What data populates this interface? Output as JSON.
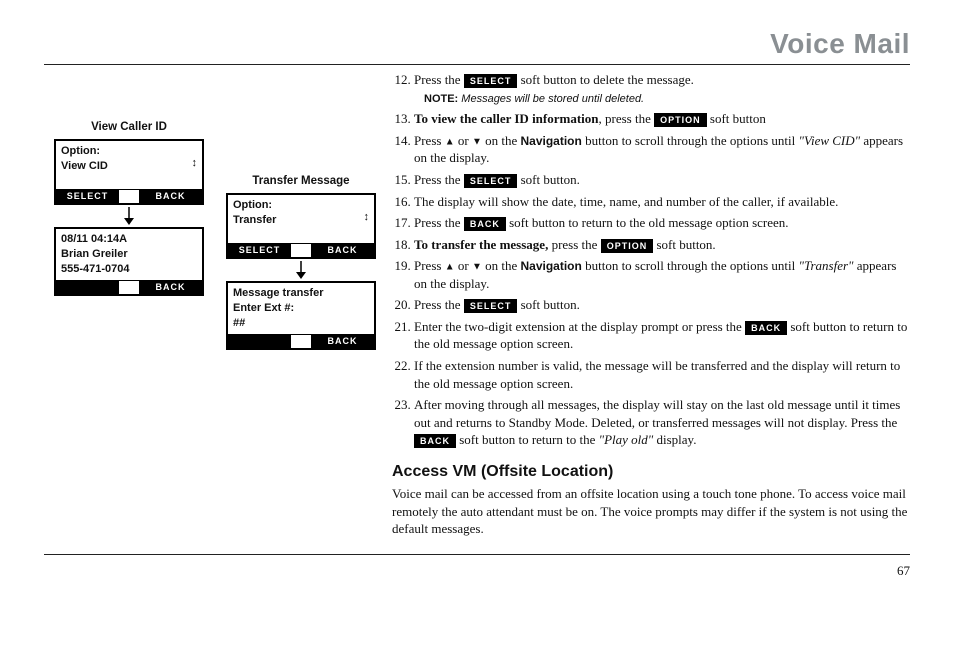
{
  "section_title": "Voice Mail",
  "page_number": "67",
  "buttons": {
    "select": "SELECT",
    "option": "OPTION",
    "back": "BACK"
  },
  "nav_word": "Navigation",
  "subheading": "Access VM (Offsite Location)",
  "access_paragraph": "Voice mail can be accessed from an offsite location using a touch tone phone. To access voice mail remotely the auto attendant must be on. The voice prompts may differ if the system is not using the default messages.",
  "steps": {
    "s12a": "Press the ",
    "s12b": " soft button to delete the message.",
    "note_label": "NOTE:",
    "note_body": " Messages will be stored until deleted.",
    "s13a": "To view the caller ID information",
    "s13b": ", press the ",
    "s13c": " soft button",
    "s14a": "Press ",
    "s14mid": " on the ",
    "s14b": " button to scroll through the options until ",
    "s14c": "\"View CID\"",
    "s14d": " appears on the display.",
    "s15a": "Press the ",
    "s15b": " soft button.",
    "s16": "The display will show the date, time, name, and number of the caller, if available.",
    "s17a": "Press the ",
    "s17b": " soft button to return to the old message option screen.",
    "s18a": "To transfer the message,",
    "s18b": " press the ",
    "s18c": " soft button.",
    "s19a": "Press ",
    "s19mid": " on the ",
    "s19b": " button to scroll through the options until ",
    "s19c": "\"Transfer\"",
    "s19d": " appears on the display.",
    "s20a": "Press the ",
    "s20b": " soft button.",
    "s21a": "Enter the two-digit extension at the display prompt or press the ",
    "s21b": " soft button to return to the old message option screen.",
    "s22": "If the extension number is valid, the message will be transferred and the display will return to the old message option screen.",
    "s23a": "After moving through all messages, the display will stay on the last old message until it times out and returns to Standby Mode. Deleted, or transferred messages will not display. Press the ",
    "s23b": " soft button to return to the ",
    "s23c": "\"Play old\"",
    "s23d": " display."
  },
  "or_word": " or ",
  "fig1": {
    "label": "View Caller ID",
    "screen1": {
      "l1": "Option:",
      "l2": "View CID",
      "left": "SELECT",
      "right": "BACK"
    },
    "screen2": {
      "l1": "08/11 04:14A",
      "l2": "Brian Greiler",
      "l3": "555-471-0704",
      "right": "BACK"
    }
  },
  "fig2": {
    "label": "Transfer Message",
    "screen1": {
      "l1": "Option:",
      "l2": "Transfer",
      "left": "SELECT",
      "right": "BACK"
    },
    "screen2": {
      "l1": "Message transfer",
      "l2": "Enter Ext #:",
      "l3": "##",
      "right": "BACK"
    }
  }
}
